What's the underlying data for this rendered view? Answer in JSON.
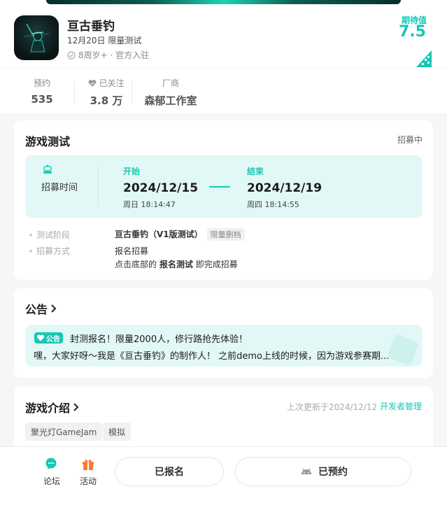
{
  "header": {
    "title": "亘古垂钓",
    "date_line": "12月20日 限量测试",
    "meta": "8周岁+ · 官方入驻",
    "expect_label": "期待值",
    "expect_value": "7.5"
  },
  "stats": [
    {
      "label": "预约",
      "value": "535"
    },
    {
      "label": "已关注",
      "value": "3.8 万"
    },
    {
      "label": "厂商",
      "value": "森郁工作室"
    }
  ],
  "test": {
    "title": "游戏测试",
    "status": "招募中",
    "recruit_label": "招募时间",
    "start_label": "开始",
    "start_date": "2024/12/15",
    "start_time": "周日 18:14:47",
    "end_label": "结束",
    "end_date": "2024/12/19",
    "end_time": "周四 18:14:55",
    "phase_label": "测试阶段",
    "phase_value": "亘古垂钓（V1版测试）",
    "phase_tag": "限量删档",
    "method_label": "招募方式",
    "method_line1": "报名招募",
    "method_line2_pre": "点击底部的",
    "method_line2_bold": "报名测试",
    "method_line2_post": "即完成招募"
  },
  "notice": {
    "title": "公告",
    "badge": "公告",
    "headline": "封测报名！限量2000人，修行路抢先体验！",
    "body": "嘿，大家好呀～我是《亘古垂钓》的制作人！ 之前demo上线的时候，因为游戏参赛期..."
  },
  "intro": {
    "title": "游戏介绍",
    "updated": "上次更新于2024/12/12",
    "dev_manage": "开发者管理",
    "tags": [
      "聚光灯GameJam",
      "模拟"
    ]
  },
  "bottom": {
    "forum": "论坛",
    "activity": "活动",
    "signed_up": "已报名",
    "reserved": "已预约"
  },
  "colors": {
    "accent": "#17c7b4",
    "accent_bg": "#e2f8f6"
  }
}
